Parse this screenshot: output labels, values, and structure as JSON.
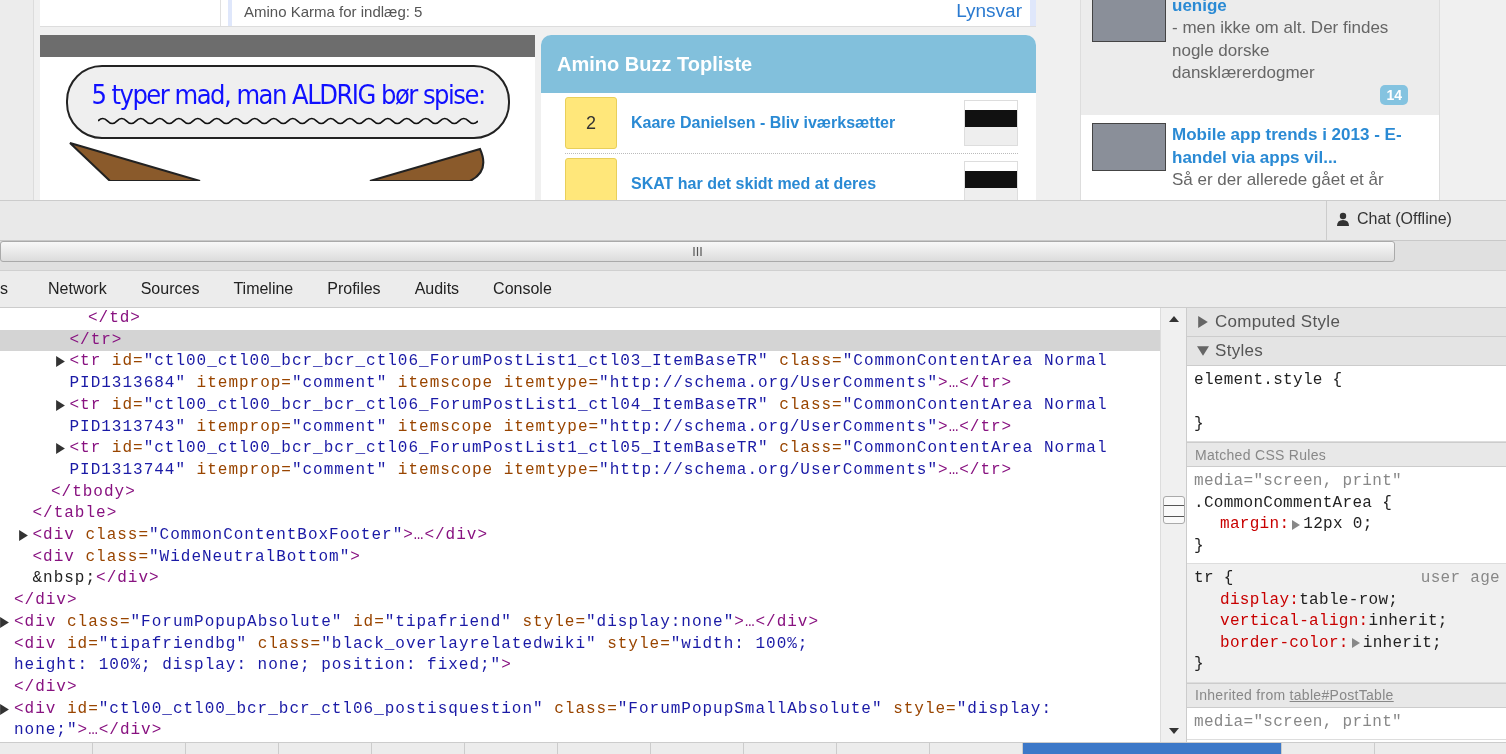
{
  "page": {
    "comment_bar": {
      "karma": "Amino Karma for indlæg: 5",
      "reply_link": "Lynsvar"
    },
    "image_card": {
      "caption": "5 typer mad, man ALDRIG bør spise:"
    },
    "buzz": {
      "title": "Amino Buzz Topliste",
      "items": [
        {
          "rank": "2",
          "title": "Kaare Danielsen - Bliv iværksætter"
        },
        {
          "title": "SKAT har det skidt med at deres"
        }
      ]
    },
    "articles": [
      {
        "title": "uenige",
        "excerpt": "- men ikke om alt. Der findes nogle dorske dansklærerdogmer",
        "comments": "14",
        "highlighted": false
      },
      {
        "title": "Mobile app trends i 2013 - E-handel via apps vil...",
        "excerpt": "Så er der allerede gået et år",
        "highlighted": true
      }
    ]
  },
  "dock_bar": {
    "chat": "Chat (Offline)"
  },
  "devtools": {
    "tabs": [
      {
        "label": "s"
      },
      {
        "label": "Network"
      },
      {
        "label": "Sources"
      },
      {
        "label": "Timeline"
      },
      {
        "label": "Profiles"
      },
      {
        "label": "Audits"
      },
      {
        "label": "Console"
      }
    ],
    "dom_tree": [
      {
        "children": [
          {
            "children": [
              {
                "children": [
                  {
                    "children": [
                      {
                        "children": [
                          {
                            "collapsed": false,
                            "selected": false,
                            "lines": [
                              [
                                {
                                  "kind": "tag",
                                  "text": "</td>"
                                }
                              ]
                            ]
                          }
                        ]
                      },
                      {
                        "collapsed": false,
                        "selected": true,
                        "lines": [
                          [
                            {
                              "kind": "tag",
                              "text": "</tr>"
                            }
                          ]
                        ]
                      },
                      {
                        "collapsed": true,
                        "selected": false,
                        "lines": [
                          [
                            {
                              "kind": "tag",
                              "text": "<tr"
                            },
                            {
                              "kind": "attr",
                              "text": " id="
                            },
                            {
                              "kind": "value",
                              "text": "\"ctl00_ctl00_bcr_bcr_ctl06_ForumPostList1_ctl03_ItemBaseTR\""
                            },
                            {
                              "kind": "attr",
                              "text": " class="
                            },
                            {
                              "kind": "value",
                              "text": "\"CommonContentArea Normal"
                            }
                          ],
                          [
                            {
                              "kind": "value",
                              "text": "PID1313684\""
                            },
                            {
                              "kind": "attr",
                              "text": " itemprop="
                            },
                            {
                              "kind": "value",
                              "text": "\"comment\""
                            },
                            {
                              "kind": "attr",
                              "text": " itemscope itemtype="
                            },
                            {
                              "kind": "value",
                              "text": "\"http://schema.org/UserComments\""
                            },
                            {
                              "kind": "tag",
                              "text": ">…</tr>"
                            }
                          ]
                        ]
                      },
                      {
                        "collapsed": true,
                        "selected": false,
                        "lines": [
                          [
                            {
                              "kind": "tag",
                              "text": "<tr"
                            },
                            {
                              "kind": "attr",
                              "text": " id="
                            },
                            {
                              "kind": "value",
                              "text": "\"ctl00_ctl00_bcr_bcr_ctl06_ForumPostList1_ctl04_ItemBaseTR\""
                            },
                            {
                              "kind": "attr",
                              "text": " class="
                            },
                            {
                              "kind": "value",
                              "text": "\"CommonContentArea Normal"
                            }
                          ],
                          [
                            {
                              "kind": "value",
                              "text": "PID1313743\""
                            },
                            {
                              "kind": "attr",
                              "text": " itemprop="
                            },
                            {
                              "kind": "value",
                              "text": "\"comment\""
                            },
                            {
                              "kind": "attr",
                              "text": " itemscope itemtype="
                            },
                            {
                              "kind": "value",
                              "text": "\"http://schema.org/UserComments\""
                            },
                            {
                              "kind": "tag",
                              "text": ">…</tr>"
                            }
                          ]
                        ]
                      },
                      {
                        "collapsed": true,
                        "selected": false,
                        "lines": [
                          [
                            {
                              "kind": "tag",
                              "text": "<tr"
                            },
                            {
                              "kind": "attr",
                              "text": " id="
                            },
                            {
                              "kind": "value",
                              "text": "\"ctl00_ctl00_bcr_bcr_ctl06_ForumPostList1_ctl05_ItemBaseTR\""
                            },
                            {
                              "kind": "attr",
                              "text": " class="
                            },
                            {
                              "kind": "value",
                              "text": "\"CommonContentArea Normal"
                            }
                          ],
                          [
                            {
                              "kind": "value",
                              "text": "PID1313744\""
                            },
                            {
                              "kind": "attr",
                              "text": " itemprop="
                            },
                            {
                              "kind": "value",
                              "text": "\"comment\""
                            },
                            {
                              "kind": "attr",
                              "text": " itemscope itemtype="
                            },
                            {
                              "kind": "value",
                              "text": "\"http://schema.org/UserComments\""
                            },
                            {
                              "kind": "tag",
                              "text": ">…</tr>"
                            }
                          ]
                        ]
                      }
                    ]
                  },
                  {
                    "collapsed": false,
                    "selected": false,
                    "lines": [
                      [
                        {
                          "kind": "tag",
                          "text": "</tbody>"
                        }
                      ]
                    ]
                  }
                ]
              },
              {
                "collapsed": false,
                "selected": false,
                "lines": [
                  [
                    {
                      "kind": "tag",
                      "text": "</table>"
                    }
                  ]
                ]
              },
              {
                "collapsed": true,
                "selected": false,
                "lines": [
                  [
                    {
                      "kind": "tag",
                      "text": "<div"
                    },
                    {
                      "kind": "attr",
                      "text": " class="
                    },
                    {
                      "kind": "value",
                      "text": "\"CommonContentBoxFooter\""
                    },
                    {
                      "kind": "tag",
                      "text": ">…</div>"
                    }
                  ]
                ]
              },
              {
                "collapsed": false,
                "selected": false,
                "lines": [
                  [
                    {
                      "kind": "tag",
                      "text": "<div"
                    },
                    {
                      "kind": "attr",
                      "text": " class="
                    },
                    {
                      "kind": "value",
                      "text": "\"WideNeutralBottom\""
                    },
                    {
                      "kind": "tag",
                      "text": ">"
                    }
                  ],
                  [
                    {
                      "kind": "text",
                      "text": "&nbsp;"
                    },
                    {
                      "kind": "tag",
                      "text": "</div>"
                    }
                  ]
                ]
              }
            ]
          },
          {
            "collapsed": false,
            "selected": false,
            "lines": [
              [
                {
                  "kind": "tag",
                  "text": "</div>"
                }
              ]
            ]
          },
          {
            "collapsed": true,
            "selected": false,
            "lines": [
              [
                {
                  "kind": "tag",
                  "text": "<div"
                },
                {
                  "kind": "attr",
                  "text": " class="
                },
                {
                  "kind": "value",
                  "text": "\"ForumPopupAbsolute\""
                },
                {
                  "kind": "attr",
                  "text": " id="
                },
                {
                  "kind": "value",
                  "text": "\"tipafriend\""
                },
                {
                  "kind": "attr",
                  "text": " style="
                },
                {
                  "kind": "value",
                  "text": "\"display:none\""
                },
                {
                  "kind": "tag",
                  "text": ">…</div>"
                }
              ]
            ]
          },
          {
            "collapsed": false,
            "selected": false,
            "lines": [
              [
                {
                  "kind": "tag",
                  "text": "<div"
                },
                {
                  "kind": "attr",
                  "text": " id="
                },
                {
                  "kind": "value",
                  "text": "\"tipafriendbg\""
                },
                {
                  "kind": "attr",
                  "text": " class="
                },
                {
                  "kind": "value",
                  "text": "\"black_overlayrelatedwiki\""
                },
                {
                  "kind": "attr",
                  "text": " style="
                },
                {
                  "kind": "value",
                  "text": "\"width: 100%;"
                }
              ],
              [
                {
                  "kind": "value",
                  "text": "height: 100%; display: none; position: fixed;\""
                },
                {
                  "kind": "tag",
                  "text": ">"
                }
              ]
            ]
          },
          {
            "collapsed": false,
            "selected": false,
            "lines": [
              [
                {
                  "kind": "tag",
                  "text": "</div>"
                }
              ]
            ]
          },
          {
            "collapsed": true,
            "selected": false,
            "lines": [
              [
                {
                  "kind": "tag",
                  "text": "<div"
                },
                {
                  "kind": "attr",
                  "text": " id="
                },
                {
                  "kind": "value",
                  "text": "\"ctl00_ctl00_bcr_bcr_ctl06_postisquestion\""
                },
                {
                  "kind": "attr",
                  "text": " class="
                },
                {
                  "kind": "value",
                  "text": "\"ForumPopupSmallAbsolute\""
                },
                {
                  "kind": "attr",
                  "text": " style="
                },
                {
                  "kind": "value",
                  "text": "\"display:"
                }
              ],
              [
                {
                  "kind": "value",
                  "text": "none;\""
                },
                {
                  "kind": "tag",
                  "text": ">…</div>"
                }
              ]
            ]
          }
        ]
      }
    ],
    "styles_pane": [
      {
        "kind": "pane-header",
        "label": "Computed Style",
        "expanded": false
      },
      {
        "kind": "pane-header",
        "label": "Styles",
        "expanded": true
      },
      {
        "kind": "rule",
        "selector": "element.style {",
        "close": "}"
      },
      {
        "kind": "subheader",
        "label": "Matched CSS Rules"
      },
      {
        "kind": "rule",
        "origin": "media=\"screen, print\"",
        "selector": ".CommonCommentArea {",
        "properties": [
          {
            "name": "margin:",
            "value": "12px 0;",
            "expandable": true
          }
        ],
        "close": "}"
      },
      {
        "kind": "ua-rule",
        "selector": "tr {",
        "source": "user age",
        "properties": [
          {
            "name": "display:",
            "value": "table-row;",
            "expandable": false
          },
          {
            "name": "vertical-align:",
            "value": "inherit;",
            "expandable": false
          },
          {
            "name": "border-color:",
            "value": "inherit;",
            "expandable": true
          }
        ],
        "close": "}"
      },
      {
        "kind": "subheader",
        "label": "Inherited from",
        "link": "table#PostTable"
      },
      {
        "kind": "rule",
        "origin": "media=\"screen, print\""
      }
    ],
    "breadcrumbs": [
      {
        "selected": false
      },
      {
        "selected": false
      },
      {
        "selected": false
      },
      {
        "selected": false
      },
      {
        "selected": false
      },
      {
        "selected": false
      },
      {
        "selected": false
      },
      {
        "selected": false
      },
      {
        "selected": false
      },
      {
        "selected": false
      },
      {
        "selected": false
      },
      {
        "selected": true
      },
      {
        "selected": false
      }
    ]
  }
}
